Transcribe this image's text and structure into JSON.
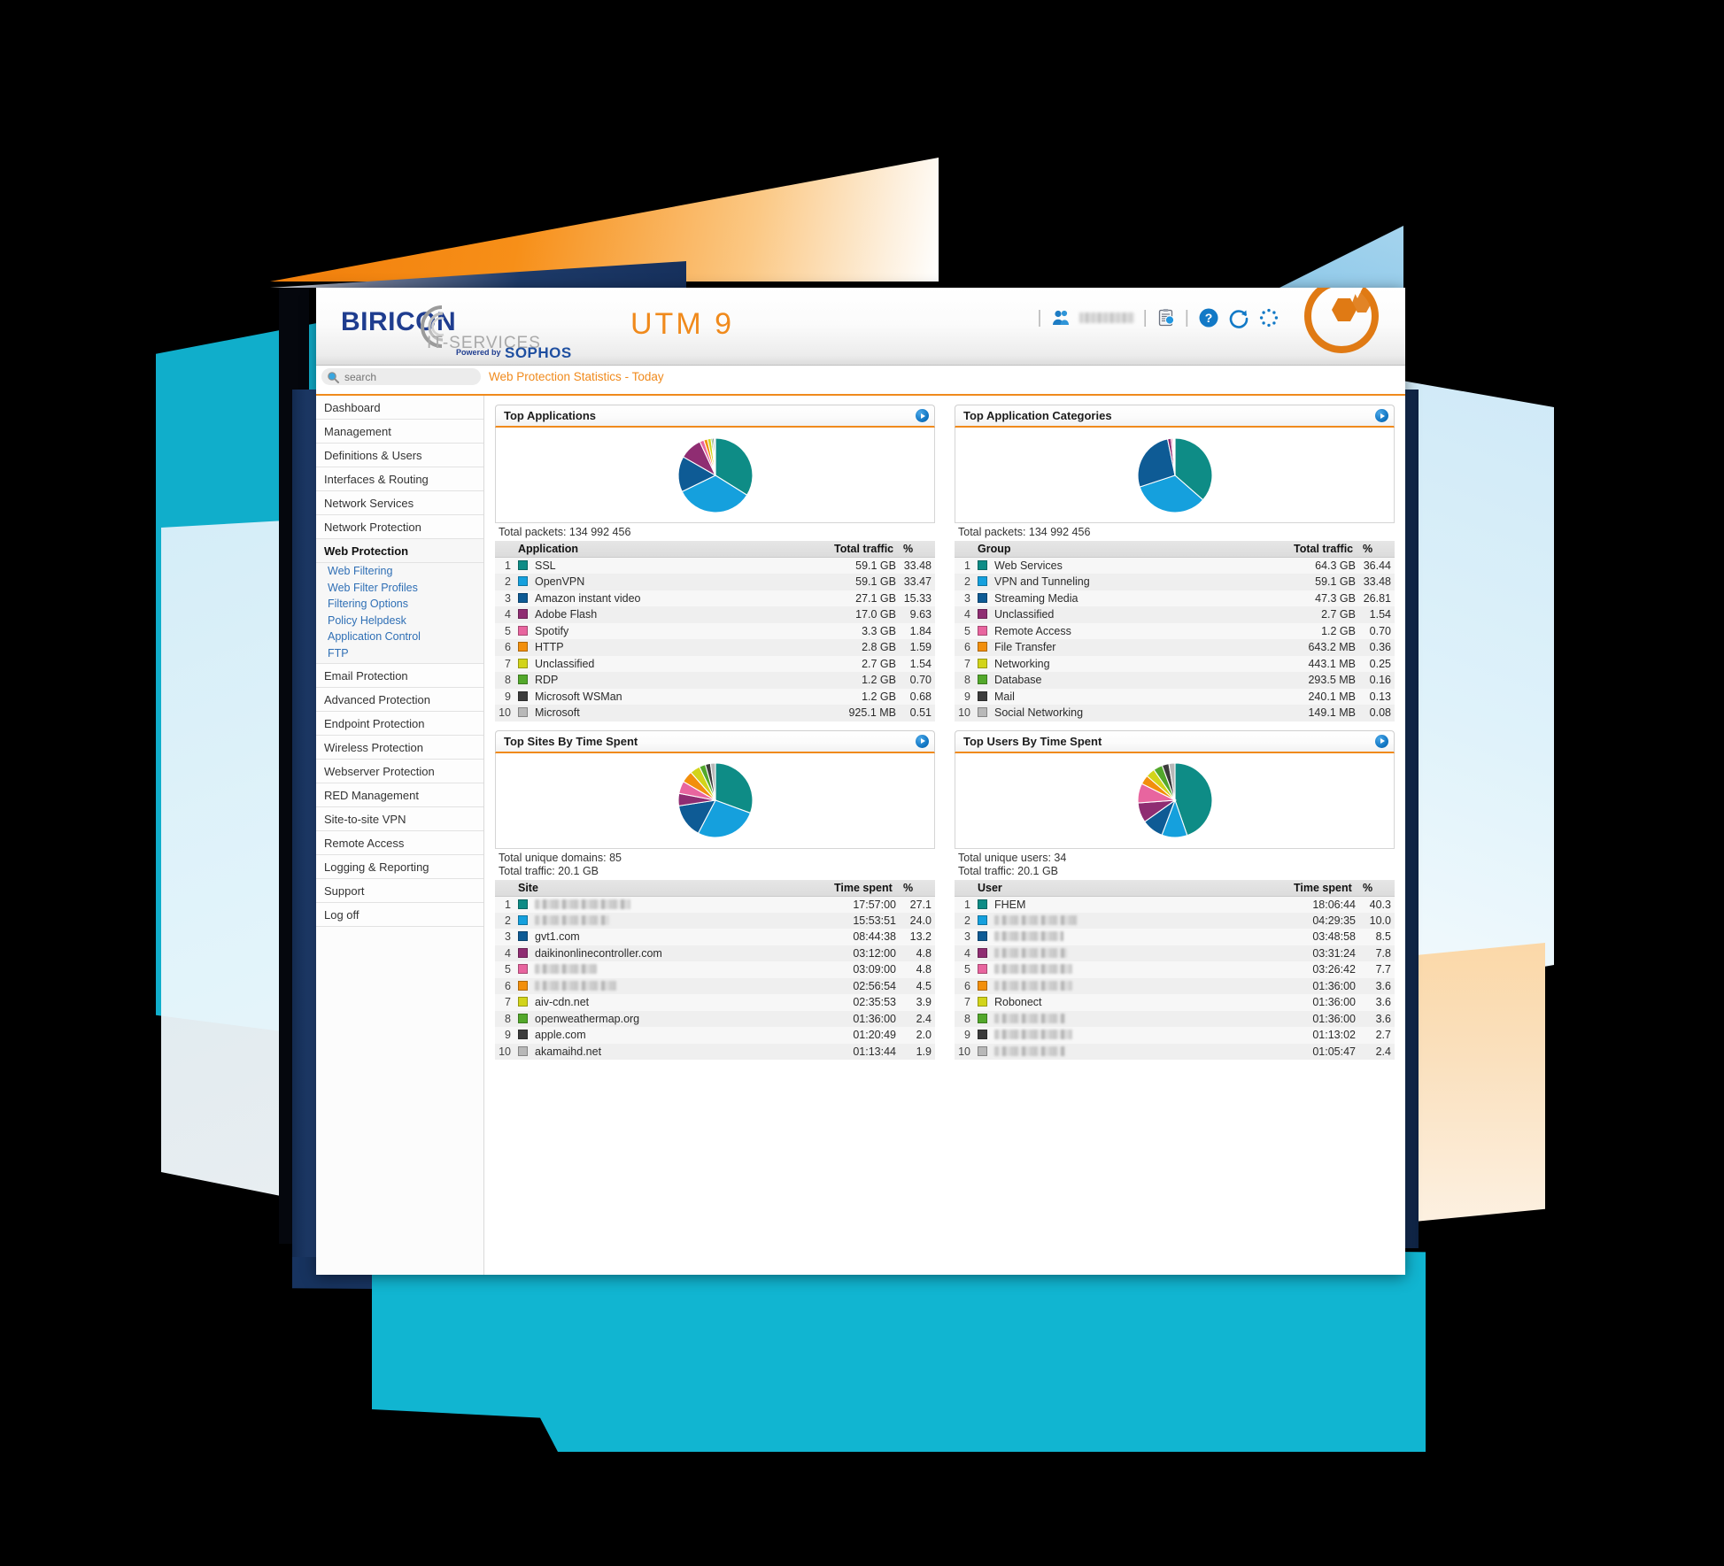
{
  "header": {
    "brand_main": "BIRICON",
    "brand_sub": "IT-SERVICES",
    "brand_powered": "Powered by",
    "brand_sophos": "SOPHOS",
    "product_title": "UTM 9",
    "user_label": "",
    "icons": [
      "users-icon",
      "clipboard-search-icon",
      "help-icon",
      "reload-icon",
      "loading-spinner-icon"
    ]
  },
  "search": {
    "placeholder": "search",
    "value": ""
  },
  "breadcrumb": "Web Protection Statistics - Today",
  "sidebar": {
    "items": [
      {
        "label": "Dashboard",
        "active": false
      },
      {
        "label": "Management",
        "active": false
      },
      {
        "label": "Definitions & Users",
        "active": false
      },
      {
        "label": "Interfaces & Routing",
        "active": false
      },
      {
        "label": "Network Services",
        "active": false
      },
      {
        "label": "Network Protection",
        "active": false
      },
      {
        "label": "Web Protection",
        "active": true
      },
      {
        "label": "Email Protection",
        "active": false
      },
      {
        "label": "Advanced Protection",
        "active": false
      },
      {
        "label": "Endpoint Protection",
        "active": false
      },
      {
        "label": "Wireless Protection",
        "active": false
      },
      {
        "label": "Webserver Protection",
        "active": false
      },
      {
        "label": "RED Management",
        "active": false
      },
      {
        "label": "Site-to-site VPN",
        "active": false
      },
      {
        "label": "Remote Access",
        "active": false
      },
      {
        "label": "Logging & Reporting",
        "active": false
      },
      {
        "label": "Support",
        "active": false
      },
      {
        "label": "Log off",
        "active": false
      }
    ],
    "sub_items": [
      "Web Filtering",
      "Web Filter Profiles",
      "Filtering Options",
      "Policy Helpdesk",
      "Application Control",
      "FTP"
    ]
  },
  "palette": {
    "teal": "#0e8c86",
    "cyan": "#15a0dd",
    "navy": "#0e5b95",
    "purple": "#8f2d72",
    "pink": "#e8659f",
    "orange": "#f28f0c",
    "yellow": "#d2d41a",
    "green": "#53a82b",
    "darkgray": "#3c3c3c",
    "lightgray": "#b8b8b8",
    "accent_orange": "#f08a1c",
    "link_blue": "#2f6fb5"
  },
  "panels": {
    "top_applications": {
      "title": "Top Applications",
      "arrow": "open-report-icon",
      "totals": [
        "Total packets: 134 992 456"
      ],
      "columns": [
        "",
        "Application",
        "Total traffic",
        "%"
      ]
    },
    "top_application_categories": {
      "title": "Top Application Categories",
      "arrow": "open-report-icon",
      "totals": [
        "Total packets: 134 992 456"
      ],
      "columns": [
        "",
        "Group",
        "Total traffic",
        "%"
      ]
    },
    "top_sites": {
      "title": "Top Sites By Time Spent",
      "arrow": "open-report-icon",
      "totals": [
        "Total unique domains: 85",
        "Total traffic: 20.1 GB"
      ],
      "columns": [
        "",
        "Site",
        "Time spent",
        "%"
      ]
    },
    "top_users": {
      "title": "Top Users By Time Spent",
      "arrow": "open-report-icon",
      "totals": [
        "Total unique users: 34",
        "Total traffic: 20.1 GB"
      ],
      "columns": [
        "",
        "User",
        "Time spent",
        "%"
      ]
    }
  },
  "chart_data": [
    {
      "type": "pie",
      "title": "Top Applications",
      "legend": "table",
      "labels": [
        "SSL",
        "OpenVPN",
        "Amazon instant video",
        "Adobe Flash",
        "Spotify",
        "HTTP",
        "Unclassified",
        "RDP",
        "Microsoft WSMan",
        "Microsoft"
      ],
      "values": [
        33.48,
        33.47,
        15.33,
        9.63,
        1.84,
        1.59,
        1.54,
        0.7,
        0.68,
        0.51
      ],
      "display_values": [
        "59.1 GB",
        "59.1 GB",
        "27.1 GB",
        "17.0 GB",
        "3.3 GB",
        "2.8 GB",
        "2.7 GB",
        "1.2 GB",
        "1.2 GB",
        "925.1 MB"
      ],
      "colors": [
        "#0e8c86",
        "#15a0dd",
        "#0e5b95",
        "#8f2d72",
        "#e8659f",
        "#f28f0c",
        "#d2d41a",
        "#53a82b",
        "#3c3c3c",
        "#b8b8b8"
      ],
      "rows": [
        {
          "rank": 1,
          "name": "SSL",
          "value": "59.1 GB",
          "pct": "33.48",
          "color": "#0e8c86",
          "redacted": false
        },
        {
          "rank": 2,
          "name": "OpenVPN",
          "value": "59.1 GB",
          "pct": "33.47",
          "color": "#15a0dd",
          "redacted": false
        },
        {
          "rank": 3,
          "name": "Amazon instant video",
          "value": "27.1 GB",
          "pct": "15.33",
          "color": "#0e5b95",
          "redacted": false
        },
        {
          "rank": 4,
          "name": "Adobe Flash",
          "value": "17.0 GB",
          "pct": "9.63",
          "color": "#8f2d72",
          "redacted": false
        },
        {
          "rank": 5,
          "name": "Spotify",
          "value": "3.3 GB",
          "pct": "1.84",
          "color": "#e8659f",
          "redacted": false
        },
        {
          "rank": 6,
          "name": "HTTP",
          "value": "2.8 GB",
          "pct": "1.59",
          "color": "#f28f0c",
          "redacted": false
        },
        {
          "rank": 7,
          "name": "Unclassified",
          "value": "2.7 GB",
          "pct": "1.54",
          "color": "#d2d41a",
          "redacted": false
        },
        {
          "rank": 8,
          "name": "RDP",
          "value": "1.2 GB",
          "pct": "0.70",
          "color": "#53a82b",
          "redacted": false
        },
        {
          "rank": 9,
          "name": "Microsoft WSMan",
          "value": "1.2 GB",
          "pct": "0.68",
          "color": "#3c3c3c",
          "redacted": false
        },
        {
          "rank": 10,
          "name": "Microsoft",
          "value": "925.1 MB",
          "pct": "0.51",
          "color": "#b8b8b8",
          "redacted": false
        }
      ]
    },
    {
      "type": "pie",
      "title": "Top Application Categories",
      "legend": "table",
      "labels": [
        "Web Services",
        "VPN and Tunneling",
        "Streaming Media",
        "Unclassified",
        "Remote Access",
        "File Transfer",
        "Networking",
        "Database",
        "Mail",
        "Social Networking"
      ],
      "values": [
        36.44,
        33.48,
        26.81,
        1.54,
        0.7,
        0.36,
        0.25,
        0.16,
        0.13,
        0.08
      ],
      "display_values": [
        "64.3 GB",
        "59.1 GB",
        "47.3 GB",
        "2.7 GB",
        "1.2 GB",
        "643.2 MB",
        "443.1 MB",
        "293.5 MB",
        "240.1 MB",
        "149.1 MB"
      ],
      "colors": [
        "#0e8c86",
        "#15a0dd",
        "#0e5b95",
        "#8f2d72",
        "#e8659f",
        "#f28f0c",
        "#d2d41a",
        "#53a82b",
        "#3c3c3c",
        "#b8b8b8"
      ],
      "rows": [
        {
          "rank": 1,
          "name": "Web Services",
          "value": "64.3 GB",
          "pct": "36.44",
          "color": "#0e8c86",
          "redacted": false
        },
        {
          "rank": 2,
          "name": "VPN and Tunneling",
          "value": "59.1 GB",
          "pct": "33.48",
          "color": "#15a0dd",
          "redacted": false
        },
        {
          "rank": 3,
          "name": "Streaming Media",
          "value": "47.3 GB",
          "pct": "26.81",
          "color": "#0e5b95",
          "redacted": false
        },
        {
          "rank": 4,
          "name": "Unclassified",
          "value": "2.7 GB",
          "pct": "1.54",
          "color": "#8f2d72",
          "redacted": false
        },
        {
          "rank": 5,
          "name": "Remote Access",
          "value": "1.2 GB",
          "pct": "0.70",
          "color": "#e8659f",
          "redacted": false
        },
        {
          "rank": 6,
          "name": "File Transfer",
          "value": "643.2 MB",
          "pct": "0.36",
          "color": "#f28f0c",
          "redacted": false
        },
        {
          "rank": 7,
          "name": "Networking",
          "value": "443.1 MB",
          "pct": "0.25",
          "color": "#d2d41a",
          "redacted": false
        },
        {
          "rank": 8,
          "name": "Database",
          "value": "293.5 MB",
          "pct": "0.16",
          "color": "#53a82b",
          "redacted": false
        },
        {
          "rank": 9,
          "name": "Mail",
          "value": "240.1 MB",
          "pct": "0.13",
          "color": "#3c3c3c",
          "redacted": false
        },
        {
          "rank": 10,
          "name": "Social Networking",
          "value": "149.1 MB",
          "pct": "0.08",
          "color": "#b8b8b8",
          "redacted": false
        }
      ]
    },
    {
      "type": "pie",
      "title": "Top Sites By Time Spent",
      "legend": "table",
      "labels": [
        "",
        "",
        "gvt1.com",
        "daikinonlinecontroller.com",
        "",
        "",
        "aiv-cdn.net",
        "openweathermap.org",
        "apple.com",
        "akamaihd.net"
      ],
      "values": [
        27.1,
        24.0,
        13.2,
        4.8,
        4.8,
        4.5,
        3.9,
        2.4,
        2.0,
        1.9
      ],
      "display_values": [
        "17:57:00",
        "15:53:51",
        "08:44:38",
        "03:12:00",
        "03:09:00",
        "02:56:54",
        "02:35:53",
        "01:36:00",
        "01:20:49",
        "01:13:44"
      ],
      "colors": [
        "#0e8c86",
        "#15a0dd",
        "#0e5b95",
        "#8f2d72",
        "#e8659f",
        "#f28f0c",
        "#d2d41a",
        "#53a82b",
        "#3c3c3c",
        "#b8b8b8"
      ],
      "rows": [
        {
          "rank": 1,
          "name": "",
          "value": "17:57:00",
          "pct": "27.1",
          "color": "#0e8c86",
          "redacted": true,
          "blur_width": 108
        },
        {
          "rank": 2,
          "name": "",
          "value": "15:53:51",
          "pct": "24.0",
          "color": "#15a0dd",
          "redacted": true,
          "blur_width": 84
        },
        {
          "rank": 3,
          "name": "gvt1.com",
          "value": "08:44:38",
          "pct": "13.2",
          "color": "#0e5b95",
          "redacted": false
        },
        {
          "rank": 4,
          "name": "daikinonlinecontroller.com",
          "value": "03:12:00",
          "pct": "4.8",
          "color": "#8f2d72",
          "redacted": false
        },
        {
          "rank": 5,
          "name": "",
          "value": "03:09:00",
          "pct": "4.8",
          "color": "#e8659f",
          "redacted": true,
          "blur_width": 70
        },
        {
          "rank": 6,
          "name": "",
          "value": "02:56:54",
          "pct": "4.5",
          "color": "#f28f0c",
          "redacted": true,
          "blur_width": 92
        },
        {
          "rank": 7,
          "name": "aiv-cdn.net",
          "value": "02:35:53",
          "pct": "3.9",
          "color": "#d2d41a",
          "redacted": false
        },
        {
          "rank": 8,
          "name": "openweathermap.org",
          "value": "01:36:00",
          "pct": "2.4",
          "color": "#53a82b",
          "redacted": false
        },
        {
          "rank": 9,
          "name": "apple.com",
          "value": "01:20:49",
          "pct": "2.0",
          "color": "#3c3c3c",
          "redacted": false
        },
        {
          "rank": 10,
          "name": "akamaihd.net",
          "value": "01:13:44",
          "pct": "1.9",
          "color": "#b8b8b8",
          "redacted": false
        }
      ]
    },
    {
      "type": "pie",
      "title": "Top Users By Time Spent",
      "legend": "table",
      "labels": [
        "FHEM",
        "",
        "",
        "",
        "",
        "",
        "Robonect",
        "",
        "",
        ""
      ],
      "values": [
        40.3,
        10.0,
        8.5,
        7.8,
        7.7,
        3.6,
        3.6,
        3.6,
        2.7,
        2.4
      ],
      "display_values": [
        "18:06:44",
        "04:29:35",
        "03:48:58",
        "03:31:24",
        "03:26:42",
        "01:36:00",
        "01:36:00",
        "01:36:00",
        "01:13:02",
        "01:05:47"
      ],
      "colors": [
        "#0e8c86",
        "#15a0dd",
        "#0e5b95",
        "#8f2d72",
        "#e8659f",
        "#f28f0c",
        "#d2d41a",
        "#53a82b",
        "#3c3c3c",
        "#b8b8b8"
      ],
      "rows": [
        {
          "rank": 1,
          "name": "FHEM",
          "value": "18:06:44",
          "pct": "40.3",
          "color": "#0e8c86",
          "redacted": false
        },
        {
          "rank": 2,
          "name": "",
          "value": "04:29:35",
          "pct": "10.0",
          "color": "#15a0dd",
          "redacted": true,
          "blur_width": 94
        },
        {
          "rank": 3,
          "name": "",
          "value": "03:48:58",
          "pct": "8.5",
          "color": "#0e5b95",
          "redacted": true,
          "blur_width": 78
        },
        {
          "rank": 4,
          "name": "",
          "value": "03:31:24",
          "pct": "7.8",
          "color": "#8f2d72",
          "redacted": true,
          "blur_width": 82
        },
        {
          "rank": 5,
          "name": "",
          "value": "03:26:42",
          "pct": "7.7",
          "color": "#e8659f",
          "redacted": true,
          "blur_width": 88
        },
        {
          "rank": 6,
          "name": "",
          "value": "01:36:00",
          "pct": "3.6",
          "color": "#f28f0c",
          "redacted": true,
          "blur_width": 88
        },
        {
          "rank": 7,
          "name": "Robonect",
          "value": "01:36:00",
          "pct": "3.6",
          "color": "#d2d41a",
          "redacted": false
        },
        {
          "rank": 8,
          "name": "",
          "value": "01:36:00",
          "pct": "3.6",
          "color": "#53a82b",
          "redacted": true,
          "blur_width": 80
        },
        {
          "rank": 9,
          "name": "",
          "value": "01:13:02",
          "pct": "2.7",
          "color": "#3c3c3c",
          "redacted": true,
          "blur_width": 88
        },
        {
          "rank": 10,
          "name": "",
          "value": "01:05:47",
          "pct": "2.4",
          "color": "#b8b8b8",
          "redacted": true,
          "blur_width": 80
        }
      ]
    }
  ]
}
